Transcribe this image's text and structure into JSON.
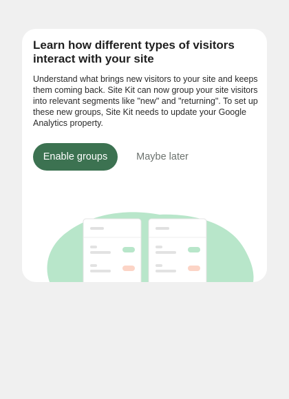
{
  "card": {
    "title": "Learn how different types of visitors interact with your site",
    "description": "Understand what brings new visitors to your site and keeps them coming back. Site Kit can now group your site visitors into relevant segments like \"new\" and \"returning\". To set up these new groups, Site Kit needs to update your Google Analytics property.",
    "primary_button_label": "Enable groups",
    "secondary_button_label": "Maybe later"
  },
  "colors": {
    "page_background": "#f0f0f0",
    "card_background": "#ffffff",
    "primary_button": "#3c7251",
    "secondary_text": "#6c726e",
    "blob": "#b8e6ca",
    "pill_green": "#b8e6ca",
    "pill_red": "#fcd4c6"
  }
}
